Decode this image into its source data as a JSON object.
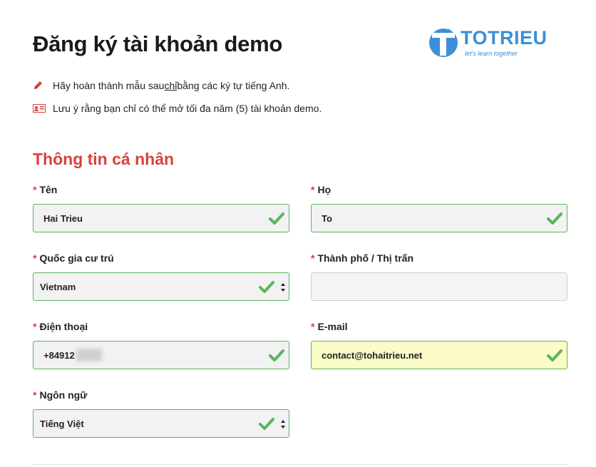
{
  "page": {
    "title": "Đăng ký tài khoản demo"
  },
  "logo": {
    "text": "TOTRIEU",
    "tagline": "let's learn together",
    "color": "#3b8fd6"
  },
  "notes": {
    "line1_before": "Hãy hoàn thành mẫu sau ",
    "line1_underlined": "chỉ",
    "line1_after": " bằng các ký tự tiếng Anh.",
    "line2": "Lưu ý rằng bạn chỉ có thể mở tối đa năm (5) tài khoản demo."
  },
  "section": {
    "title": "Thông tin cá nhân"
  },
  "required_mark": "*",
  "form": {
    "first_name": {
      "label": "Tên",
      "value": "Hai Trieu"
    },
    "last_name": {
      "label": "Họ",
      "value": "To"
    },
    "country": {
      "label": "Quốc gia cư trú",
      "value": "Vietnam"
    },
    "city": {
      "label": "Thành phố / Thị trấn",
      "value": ""
    },
    "phone": {
      "label": "Điện thoại",
      "value": "+84912"
    },
    "email": {
      "label": "E-mail",
      "value": "contact@tohaitrieu.net"
    },
    "language": {
      "label": "Ngôn ngữ",
      "value": "Tiếng Việt"
    }
  },
  "colors": {
    "accent": "#d9403c",
    "valid": "#5ab55a",
    "autofill": "#fbfbc8"
  },
  "icons": [
    "pencil-icon",
    "id-card-icon",
    "check-icon",
    "select-arrows-icon"
  ]
}
